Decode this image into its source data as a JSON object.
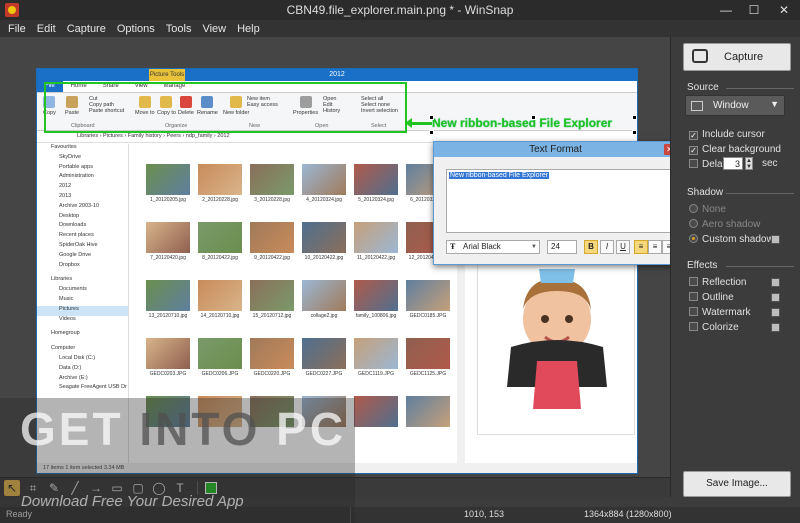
{
  "window": {
    "title": "CBN49.file_explorer.main.png * - WinSnap",
    "minimize": "—",
    "maximize": "☐",
    "close": "✕"
  },
  "menu": [
    "File",
    "Edit",
    "Capture",
    "Options",
    "Tools",
    "View",
    "Help"
  ],
  "explorer": {
    "title": "2012",
    "picture_tools": "Picture Tools",
    "tabs": [
      "File",
      "Home",
      "Share",
      "View",
      "Manage"
    ],
    "ribbon": {
      "buttons": [
        "Copy",
        "Paste",
        "Cut",
        "Copy path",
        "Paste shortcut",
        "Move to",
        "Copy to",
        "Delete",
        "Rename",
        "New folder",
        "New item",
        "Easy access",
        "Properties",
        "Open",
        "Edit",
        "History",
        "Select all",
        "Select none",
        "Invert selection"
      ],
      "groups": [
        "Clipboard",
        "Organize",
        "New",
        "Open",
        "Select"
      ]
    },
    "address": "Libraries › Pictures › Family history › Peers › ndp_family › 2012",
    "nav": [
      {
        "label": "Favourites",
        "head": true
      },
      {
        "label": "SkyDrive"
      },
      {
        "label": "Portable apps"
      },
      {
        "label": "Administration"
      },
      {
        "label": "2012"
      },
      {
        "label": "2013"
      },
      {
        "label": "Archive 2003-10"
      },
      {
        "label": "Desktop"
      },
      {
        "label": "Downloads"
      },
      {
        "label": "Recent places"
      },
      {
        "label": "SpiderOak Hive"
      },
      {
        "label": "Google Drive"
      },
      {
        "label": "Dropbox"
      },
      {
        "label": "",
        "spacer": true
      },
      {
        "label": "Libraries",
        "head": true
      },
      {
        "label": "Documents"
      },
      {
        "label": "Music"
      },
      {
        "label": "Pictures",
        "sel": true
      },
      {
        "label": "Videos"
      },
      {
        "label": "",
        "spacer": true
      },
      {
        "label": "Homegroup",
        "head": true
      },
      {
        "label": "",
        "spacer": true
      },
      {
        "label": "Computer",
        "head": true
      },
      {
        "label": "Local Disk (C:)"
      },
      {
        "label": "Data (D:)"
      },
      {
        "label": "Archive (E:)"
      },
      {
        "label": "Seagate FreeAgent USB Dr"
      }
    ],
    "files": [
      "1_20120205.jpg",
      "2_20120228.jpg",
      "3_20120228.jpg",
      "4_20120324.jpg",
      "5_20120324.jpg",
      "6_20120324.jpg",
      "7_20120420.jpg",
      "8_20120422.jpg",
      "9_20120422.jpg",
      "10_20120422.jpg",
      "11_20120422.jpg",
      "12_20120422.jpg",
      "13_20120710.jpg",
      "14_20120710.jpg",
      "15_20120712.jpg",
      "collage2.jpg",
      "family_100806.jpg",
      "GEDC0185.JPG",
      "GEDC0203.JPG",
      "GEDC0206.JPG",
      "GEDC0220.JPG",
      "GEDC0227.JPG",
      "GEDC1119.JPG",
      "GEDC1125.JPG",
      "",
      "",
      "",
      "",
      "",
      ""
    ],
    "status": "17 items    1 item selected  3.34 MB",
    "callout": "New ribbon-based File Explorer"
  },
  "text_format": {
    "title": "Text Format",
    "text": "New ribbon-based File Explorer",
    "font": "Arial Black",
    "size": "24",
    "bold": "B",
    "italic": "I",
    "underline": "U",
    "align": [
      "≡",
      "≡",
      "≡"
    ]
  },
  "side": {
    "capture": "Capture",
    "source_label": "Source",
    "source_value": "Window",
    "include_cursor": "Include cursor",
    "clear_background": "Clear background",
    "delay_label": "Delay:",
    "delay_value": "3",
    "delay_unit": "sec",
    "shadow_label": "Shadow",
    "shadow_none": "None",
    "shadow_aero": "Aero shadow",
    "shadow_custom": "Custom shadow",
    "effects_label": "Effects",
    "effects": [
      "Reflection",
      "Outline",
      "Watermark",
      "Colorize"
    ],
    "save": "Save Image..."
  },
  "toolbar": {
    "tools": [
      "↖",
      "⌗",
      "✎",
      "╱",
      "→",
      "▭",
      "▢",
      "◯",
      "T"
    ]
  },
  "status": {
    "ready": "Ready",
    "coords": "1010, 153",
    "size": "1364x884 (1280x800)"
  },
  "watermark": {
    "get": "GET ",
    "into": "INTO",
    "pc": " PC",
    "tagline": "Download Free Your Desired App"
  },
  "colors": {
    "accent_green": "#21c420",
    "explorer_blue": "#1a70c6",
    "tool_active": "#e0b24a"
  }
}
